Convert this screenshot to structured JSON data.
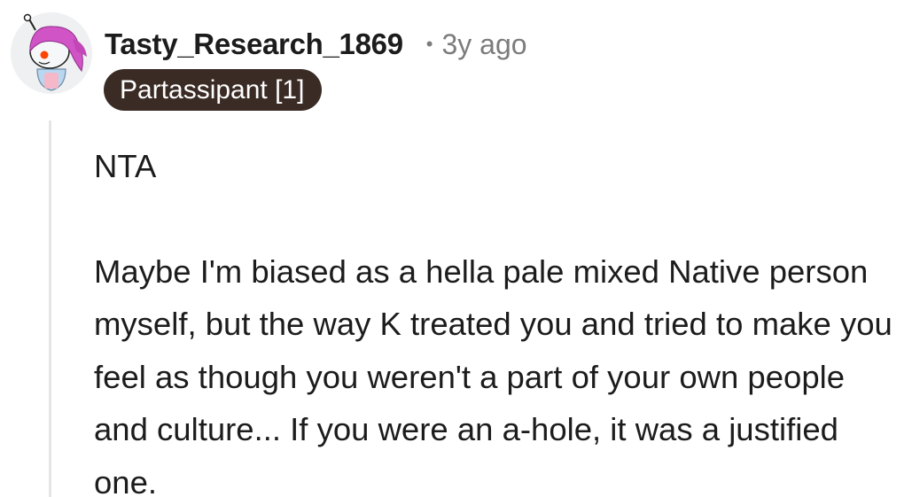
{
  "comment": {
    "author": "Tasty_Research_1869",
    "separator": "•",
    "timestamp": "3y ago",
    "flair": "Partassipant [1]",
    "avatar_icon": "snoo-avatar-icon",
    "paragraphs": [
      "NTA",
      "Maybe I'm biased as a hella pale mixed Native person myself, but the way K treated you and tried to make you feel as though you weren't a part of your own people and culture... If you were an a-hole, it was a justified one."
    ]
  },
  "colors": {
    "flair_background": "#3a2b25",
    "flair_text": "#ffffff",
    "timestamp": "#7c7c7c",
    "thread_line": "#e5e5e5",
    "avatar_hair": "#d154c6",
    "avatar_eye": "#ff4500"
  }
}
